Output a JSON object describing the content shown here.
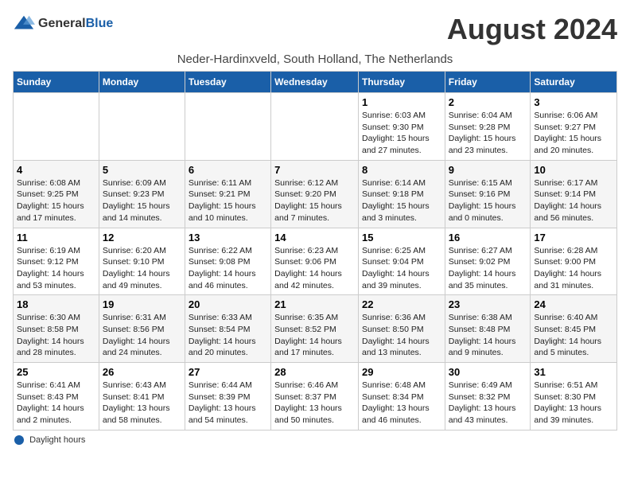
{
  "header": {
    "logo_line1": "General",
    "logo_line2": "Blue",
    "title": "August 2024",
    "subtitle": "Neder-Hardinxveld, South Holland, The Netherlands"
  },
  "weekdays": [
    "Sunday",
    "Monday",
    "Tuesday",
    "Wednesday",
    "Thursday",
    "Friday",
    "Saturday"
  ],
  "weeks": [
    [
      {
        "num": "",
        "info": ""
      },
      {
        "num": "",
        "info": ""
      },
      {
        "num": "",
        "info": ""
      },
      {
        "num": "",
        "info": ""
      },
      {
        "num": "1",
        "info": "Sunrise: 6:03 AM\nSunset: 9:30 PM\nDaylight: 15 hours and 27 minutes."
      },
      {
        "num": "2",
        "info": "Sunrise: 6:04 AM\nSunset: 9:28 PM\nDaylight: 15 hours and 23 minutes."
      },
      {
        "num": "3",
        "info": "Sunrise: 6:06 AM\nSunset: 9:27 PM\nDaylight: 15 hours and 20 minutes."
      }
    ],
    [
      {
        "num": "4",
        "info": "Sunrise: 6:08 AM\nSunset: 9:25 PM\nDaylight: 15 hours and 17 minutes."
      },
      {
        "num": "5",
        "info": "Sunrise: 6:09 AM\nSunset: 9:23 PM\nDaylight: 15 hours and 14 minutes."
      },
      {
        "num": "6",
        "info": "Sunrise: 6:11 AM\nSunset: 9:21 PM\nDaylight: 15 hours and 10 minutes."
      },
      {
        "num": "7",
        "info": "Sunrise: 6:12 AM\nSunset: 9:20 PM\nDaylight: 15 hours and 7 minutes."
      },
      {
        "num": "8",
        "info": "Sunrise: 6:14 AM\nSunset: 9:18 PM\nDaylight: 15 hours and 3 minutes."
      },
      {
        "num": "9",
        "info": "Sunrise: 6:15 AM\nSunset: 9:16 PM\nDaylight: 15 hours and 0 minutes."
      },
      {
        "num": "10",
        "info": "Sunrise: 6:17 AM\nSunset: 9:14 PM\nDaylight: 14 hours and 56 minutes."
      }
    ],
    [
      {
        "num": "11",
        "info": "Sunrise: 6:19 AM\nSunset: 9:12 PM\nDaylight: 14 hours and 53 minutes."
      },
      {
        "num": "12",
        "info": "Sunrise: 6:20 AM\nSunset: 9:10 PM\nDaylight: 14 hours and 49 minutes."
      },
      {
        "num": "13",
        "info": "Sunrise: 6:22 AM\nSunset: 9:08 PM\nDaylight: 14 hours and 46 minutes."
      },
      {
        "num": "14",
        "info": "Sunrise: 6:23 AM\nSunset: 9:06 PM\nDaylight: 14 hours and 42 minutes."
      },
      {
        "num": "15",
        "info": "Sunrise: 6:25 AM\nSunset: 9:04 PM\nDaylight: 14 hours and 39 minutes."
      },
      {
        "num": "16",
        "info": "Sunrise: 6:27 AM\nSunset: 9:02 PM\nDaylight: 14 hours and 35 minutes."
      },
      {
        "num": "17",
        "info": "Sunrise: 6:28 AM\nSunset: 9:00 PM\nDaylight: 14 hours and 31 minutes."
      }
    ],
    [
      {
        "num": "18",
        "info": "Sunrise: 6:30 AM\nSunset: 8:58 PM\nDaylight: 14 hours and 28 minutes."
      },
      {
        "num": "19",
        "info": "Sunrise: 6:31 AM\nSunset: 8:56 PM\nDaylight: 14 hours and 24 minutes."
      },
      {
        "num": "20",
        "info": "Sunrise: 6:33 AM\nSunset: 8:54 PM\nDaylight: 14 hours and 20 minutes."
      },
      {
        "num": "21",
        "info": "Sunrise: 6:35 AM\nSunset: 8:52 PM\nDaylight: 14 hours and 17 minutes."
      },
      {
        "num": "22",
        "info": "Sunrise: 6:36 AM\nSunset: 8:50 PM\nDaylight: 14 hours and 13 minutes."
      },
      {
        "num": "23",
        "info": "Sunrise: 6:38 AM\nSunset: 8:48 PM\nDaylight: 14 hours and 9 minutes."
      },
      {
        "num": "24",
        "info": "Sunrise: 6:40 AM\nSunset: 8:45 PM\nDaylight: 14 hours and 5 minutes."
      }
    ],
    [
      {
        "num": "25",
        "info": "Sunrise: 6:41 AM\nSunset: 8:43 PM\nDaylight: 14 hours and 2 minutes."
      },
      {
        "num": "26",
        "info": "Sunrise: 6:43 AM\nSunset: 8:41 PM\nDaylight: 13 hours and 58 minutes."
      },
      {
        "num": "27",
        "info": "Sunrise: 6:44 AM\nSunset: 8:39 PM\nDaylight: 13 hours and 54 minutes."
      },
      {
        "num": "28",
        "info": "Sunrise: 6:46 AM\nSunset: 8:37 PM\nDaylight: 13 hours and 50 minutes."
      },
      {
        "num": "29",
        "info": "Sunrise: 6:48 AM\nSunset: 8:34 PM\nDaylight: 13 hours and 46 minutes."
      },
      {
        "num": "30",
        "info": "Sunrise: 6:49 AM\nSunset: 8:32 PM\nDaylight: 13 hours and 43 minutes."
      },
      {
        "num": "31",
        "info": "Sunrise: 6:51 AM\nSunset: 8:30 PM\nDaylight: 13 hours and 39 minutes."
      }
    ]
  ],
  "footer": {
    "label": "Daylight hours"
  }
}
